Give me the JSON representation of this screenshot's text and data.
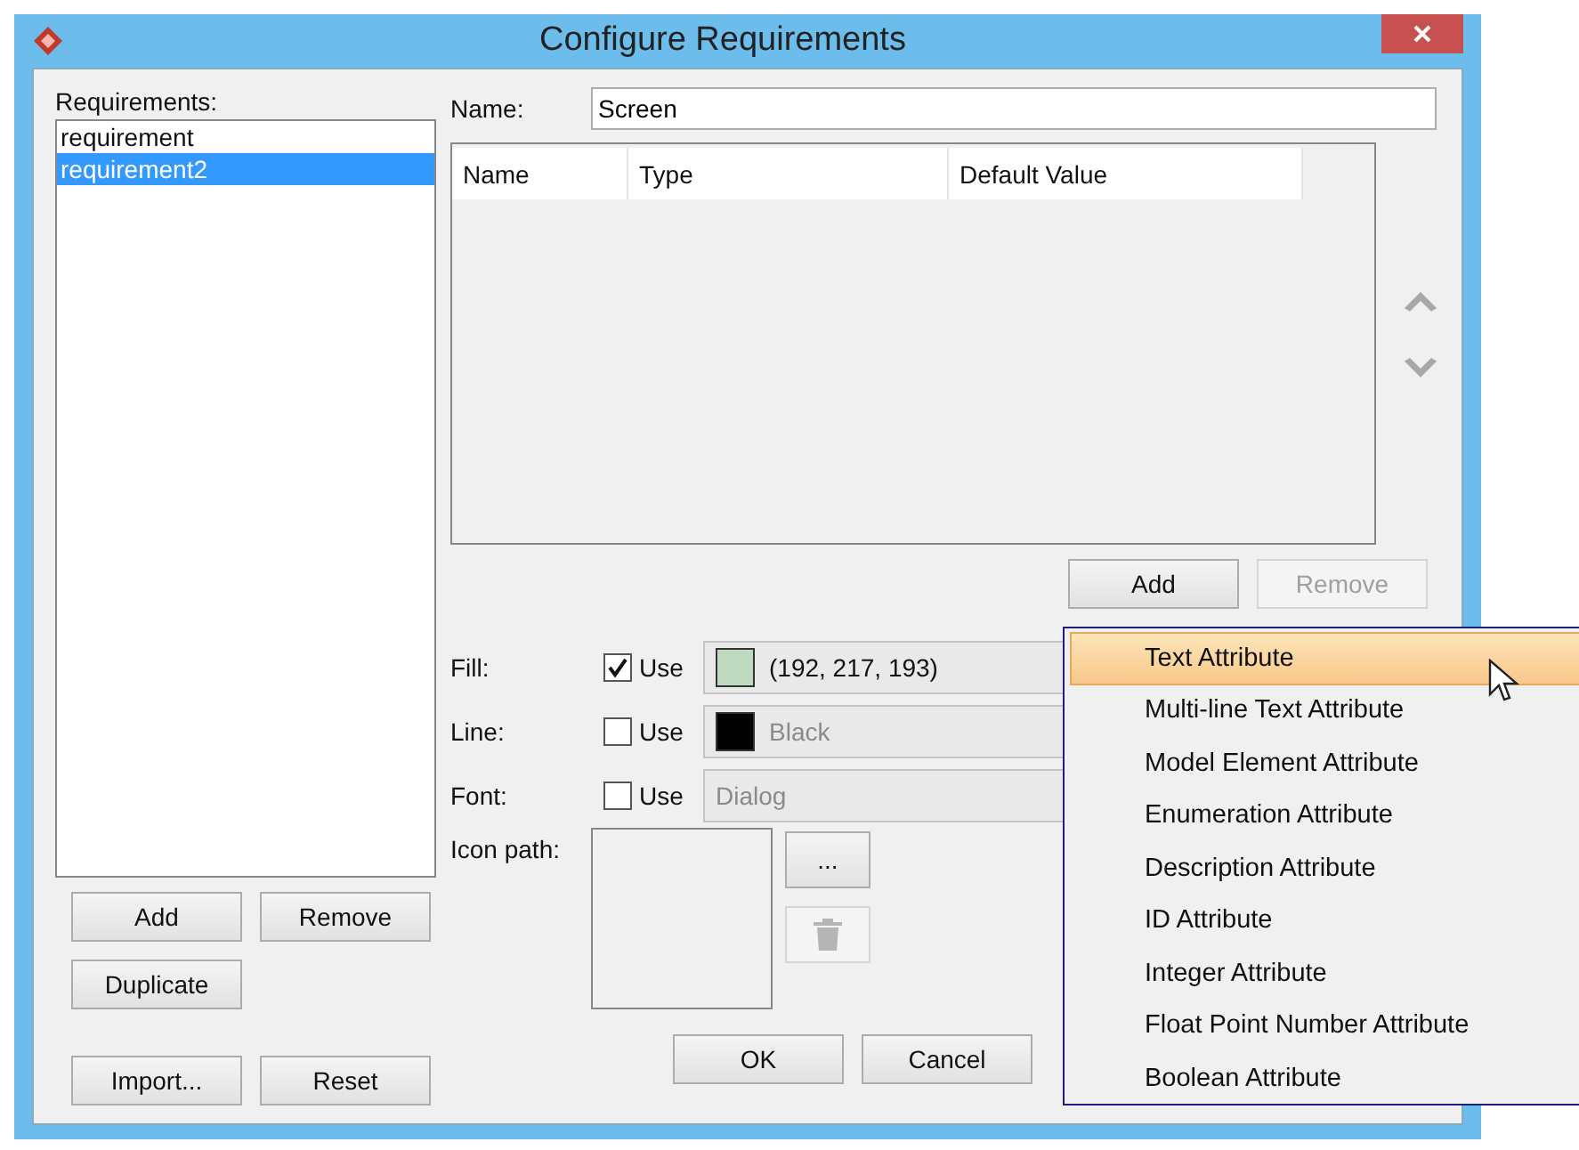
{
  "window": {
    "title": "Configure Requirements"
  },
  "requirements": {
    "label": "Requirements:",
    "items": [
      {
        "name": "requirement",
        "selected": false
      },
      {
        "name": "requirement2",
        "selected": true
      }
    ]
  },
  "list_buttons": [
    {
      "label": "Add"
    },
    {
      "label": "Remove"
    },
    {
      "label": "Duplicate"
    },
    {
      "label": "Import..."
    },
    {
      "label": "Reset"
    }
  ],
  "name_field": {
    "label": "Name:",
    "value": "Screen"
  },
  "attributes_table": {
    "columns": [
      "Name",
      "Type",
      "Default Value"
    ]
  },
  "table_buttons": [
    {
      "label": "Add",
      "disabled": false
    },
    {
      "label": "Remove",
      "disabled": true
    }
  ],
  "style_rows": [
    {
      "label": "Fill:",
      "use_label": "Use",
      "checked": true,
      "color": "#c0d9c1",
      "value": "(192, 217, 193)"
    },
    {
      "label": "Line:",
      "use_label": "Use",
      "checked": false,
      "color": "#000000",
      "value": "Black"
    },
    {
      "label": "Font:",
      "use_label": "Use",
      "checked": false,
      "value": "Dialog"
    }
  ],
  "icon_path": {
    "label": "Icon path:",
    "browse_label": "...",
    "delete_disabled": true
  },
  "dialog_buttons": [
    {
      "label": "OK"
    },
    {
      "label": "Cancel"
    }
  ],
  "add_menu": {
    "items": [
      {
        "label": "Text Attribute",
        "selected": true
      },
      {
        "label": "Multi-line Text Attribute",
        "selected": false
      },
      {
        "label": "Model Element Attribute",
        "selected": false
      },
      {
        "label": "Enumeration Attribute",
        "selected": false
      },
      {
        "label": "Description Attribute",
        "selected": false
      },
      {
        "label": "ID Attribute",
        "selected": false
      },
      {
        "label": "Integer Attribute",
        "selected": false
      },
      {
        "label": "Float Point Number Attribute",
        "selected": false
      },
      {
        "label": "Boolean Attribute",
        "selected": false
      }
    ]
  }
}
